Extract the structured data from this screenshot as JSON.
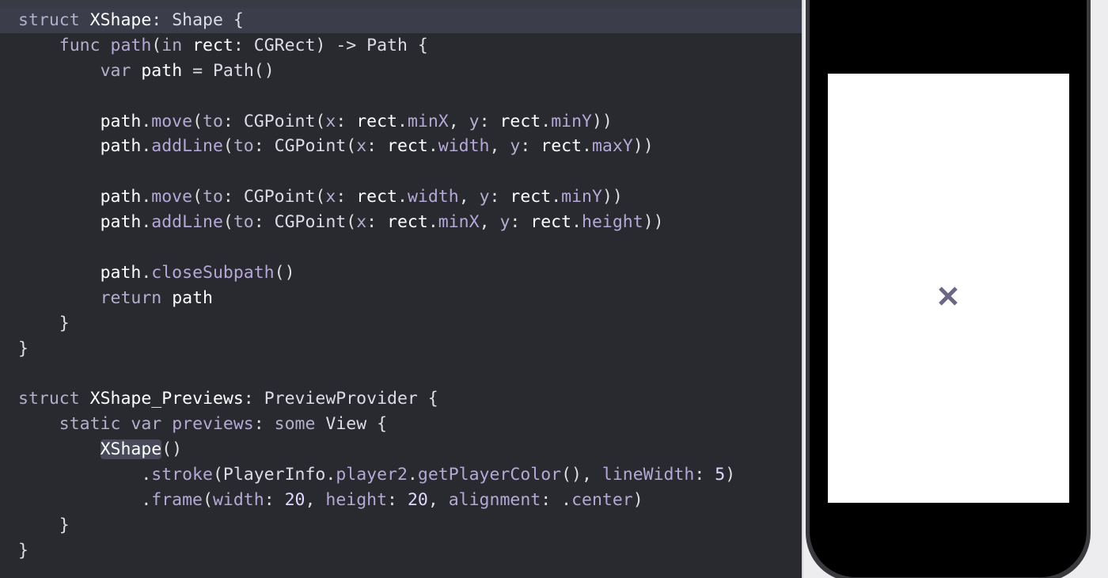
{
  "editor": {
    "lines": [
      [
        [
          "kwt",
          "struct"
        ],
        [
          "pl",
          " "
        ],
        [
          "id",
          "XShape"
        ],
        [
          "pl",
          ": "
        ],
        [
          "ty",
          "Shape"
        ],
        [
          "pl",
          " {"
        ]
      ],
      [
        [
          "pl",
          "    "
        ],
        [
          "kwt",
          "func"
        ],
        [
          "pl",
          " "
        ],
        [
          "fn",
          "path"
        ],
        [
          "pl",
          "("
        ],
        [
          "kwt",
          "in"
        ],
        [
          "pl",
          " "
        ],
        [
          "id",
          "rect"
        ],
        [
          "pl",
          ": "
        ],
        [
          "ty",
          "CGRect"
        ],
        [
          "pl",
          ") -> "
        ],
        [
          "ty",
          "Path"
        ],
        [
          "pl",
          " {"
        ]
      ],
      [
        [
          "pl",
          "        "
        ],
        [
          "kwt",
          "var"
        ],
        [
          "pl",
          " "
        ],
        [
          "id",
          "path"
        ],
        [
          "pl",
          " = "
        ],
        [
          "ty",
          "Path"
        ],
        [
          "pl",
          "()"
        ]
      ],
      [],
      [
        [
          "pl",
          "        "
        ],
        [
          "id",
          "path"
        ],
        [
          "pl",
          "."
        ],
        [
          "fn",
          "move"
        ],
        [
          "pl",
          "("
        ],
        [
          "kwt",
          "to"
        ],
        [
          "pl",
          ": "
        ],
        [
          "ty",
          "CGPoint"
        ],
        [
          "pl",
          "("
        ],
        [
          "kwt",
          "x"
        ],
        [
          "pl",
          ": "
        ],
        [
          "id",
          "rect"
        ],
        [
          "pl",
          "."
        ],
        [
          "fn",
          "minX"
        ],
        [
          "pl",
          ", "
        ],
        [
          "kwt",
          "y"
        ],
        [
          "pl",
          ": "
        ],
        [
          "id",
          "rect"
        ],
        [
          "pl",
          "."
        ],
        [
          "fn",
          "minY"
        ],
        [
          "pl",
          "))"
        ]
      ],
      [
        [
          "pl",
          "        "
        ],
        [
          "id",
          "path"
        ],
        [
          "pl",
          "."
        ],
        [
          "fn",
          "addLine"
        ],
        [
          "pl",
          "("
        ],
        [
          "kwt",
          "to"
        ],
        [
          "pl",
          ": "
        ],
        [
          "ty",
          "CGPoint"
        ],
        [
          "pl",
          "("
        ],
        [
          "kwt",
          "x"
        ],
        [
          "pl",
          ": "
        ],
        [
          "id",
          "rect"
        ],
        [
          "pl",
          "."
        ],
        [
          "fn",
          "width"
        ],
        [
          "pl",
          ", "
        ],
        [
          "kwt",
          "y"
        ],
        [
          "pl",
          ": "
        ],
        [
          "id",
          "rect"
        ],
        [
          "pl",
          "."
        ],
        [
          "fn",
          "maxY"
        ],
        [
          "pl",
          "))"
        ]
      ],
      [],
      [
        [
          "pl",
          "        "
        ],
        [
          "id",
          "path"
        ],
        [
          "pl",
          "."
        ],
        [
          "fn",
          "move"
        ],
        [
          "pl",
          "("
        ],
        [
          "kwt",
          "to"
        ],
        [
          "pl",
          ": "
        ],
        [
          "ty",
          "CGPoint"
        ],
        [
          "pl",
          "("
        ],
        [
          "kwt",
          "x"
        ],
        [
          "pl",
          ": "
        ],
        [
          "id",
          "rect"
        ],
        [
          "pl",
          "."
        ],
        [
          "fn",
          "width"
        ],
        [
          "pl",
          ", "
        ],
        [
          "kwt",
          "y"
        ],
        [
          "pl",
          ": "
        ],
        [
          "id",
          "rect"
        ],
        [
          "pl",
          "."
        ],
        [
          "fn",
          "minY"
        ],
        [
          "pl",
          "))"
        ]
      ],
      [
        [
          "pl",
          "        "
        ],
        [
          "id",
          "path"
        ],
        [
          "pl",
          "."
        ],
        [
          "fn",
          "addLine"
        ],
        [
          "pl",
          "("
        ],
        [
          "kwt",
          "to"
        ],
        [
          "pl",
          ": "
        ],
        [
          "ty",
          "CGPoint"
        ],
        [
          "pl",
          "("
        ],
        [
          "kwt",
          "x"
        ],
        [
          "pl",
          ": "
        ],
        [
          "id",
          "rect"
        ],
        [
          "pl",
          "."
        ],
        [
          "fn",
          "minX"
        ],
        [
          "pl",
          ", "
        ],
        [
          "kwt",
          "y"
        ],
        [
          "pl",
          ": "
        ],
        [
          "id",
          "rect"
        ],
        [
          "pl",
          "."
        ],
        [
          "fn",
          "height"
        ],
        [
          "pl",
          "))"
        ]
      ],
      [],
      [
        [
          "pl",
          "        "
        ],
        [
          "id",
          "path"
        ],
        [
          "pl",
          "."
        ],
        [
          "fn",
          "closeSubpath"
        ],
        [
          "pl",
          "()"
        ]
      ],
      [
        [
          "pl",
          "        "
        ],
        [
          "kwt",
          "return"
        ],
        [
          "pl",
          " "
        ],
        [
          "id",
          "path"
        ]
      ],
      [
        [
          "pl",
          "    }"
        ]
      ],
      [
        [
          "pl",
          "}"
        ]
      ],
      [],
      [
        [
          "kwt",
          "struct"
        ],
        [
          "pl",
          " "
        ],
        [
          "id",
          "XShape_Previews"
        ],
        [
          "pl",
          ": "
        ],
        [
          "ty",
          "PreviewProvider"
        ],
        [
          "pl",
          " {"
        ]
      ],
      [
        [
          "pl",
          "    "
        ],
        [
          "kwt",
          "static"
        ],
        [
          "pl",
          " "
        ],
        [
          "kwt",
          "var"
        ],
        [
          "pl",
          " "
        ],
        [
          "fn",
          "previews"
        ],
        [
          "pl",
          ": "
        ],
        [
          "kwt",
          "some"
        ],
        [
          "pl",
          " "
        ],
        [
          "ty",
          "View"
        ],
        [
          "pl",
          " {"
        ]
      ],
      [
        [
          "pl",
          "        "
        ],
        [
          "hl",
          "XShape"
        ],
        [
          "pl",
          "()"
        ]
      ],
      [
        [
          "pl",
          "            ."
        ],
        [
          "fn",
          "stroke"
        ],
        [
          "pl",
          "("
        ],
        [
          "ty",
          "PlayerInfo"
        ],
        [
          "pl",
          "."
        ],
        [
          "fn",
          "player2"
        ],
        [
          "pl",
          "."
        ],
        [
          "fn",
          "getPlayerColor"
        ],
        [
          "pl",
          "(), "
        ],
        [
          "fn",
          "lineWidth"
        ],
        [
          "pl",
          ": "
        ],
        [
          "num",
          "5"
        ],
        [
          "pl",
          ")"
        ]
      ],
      [
        [
          "pl",
          "            ."
        ],
        [
          "fn",
          "frame"
        ],
        [
          "pl",
          "("
        ],
        [
          "fn",
          "width"
        ],
        [
          "pl",
          ": "
        ],
        [
          "num",
          "20"
        ],
        [
          "pl",
          ", "
        ],
        [
          "fn",
          "height"
        ],
        [
          "pl",
          ": "
        ],
        [
          "num",
          "20"
        ],
        [
          "pl",
          ", "
        ],
        [
          "fn",
          "alignment"
        ],
        [
          "pl",
          ": ."
        ],
        [
          "fn",
          "center"
        ],
        [
          "pl",
          ")"
        ]
      ],
      [
        [
          "pl",
          "    }"
        ]
      ],
      [
        [
          "pl",
          "}"
        ]
      ]
    ]
  },
  "preview": {
    "x_color": "#6b6784"
  }
}
